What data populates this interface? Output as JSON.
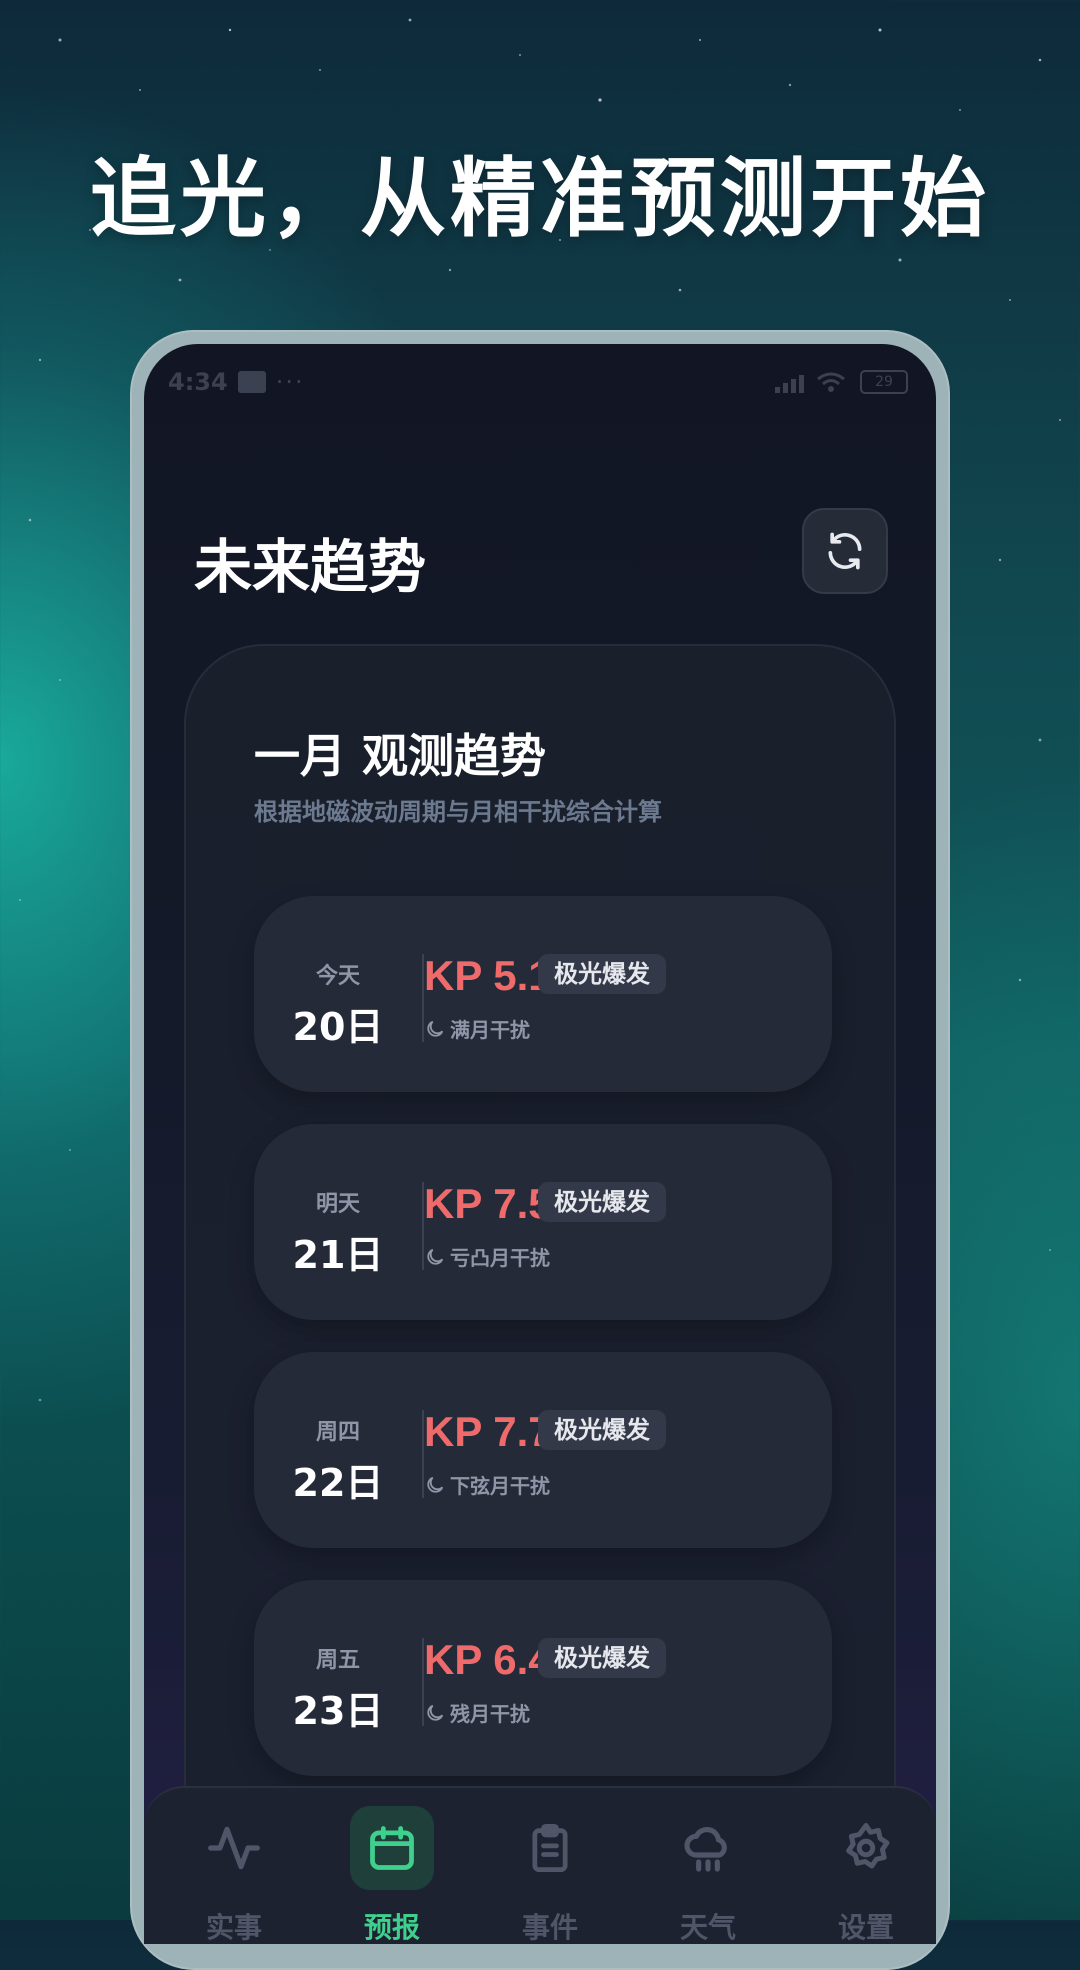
{
  "headline": "追光，从精准预测开始",
  "status_bar": {
    "time": "4:34",
    "dots": "···",
    "battery": "29"
  },
  "page": {
    "title": "未来趋势"
  },
  "trend_card": {
    "title": "一月 观测趋势",
    "subtitle": "根据地磁波动周期与月相干扰综合计算",
    "days": [
      {
        "weekday": "今天",
        "date": "20日",
        "kp": "KP 5.1",
        "badge": "极光爆发",
        "moon": "满月干扰"
      },
      {
        "weekday": "明天",
        "date": "21日",
        "kp": "KP 7.5",
        "badge": "极光爆发",
        "moon": "亏凸月干扰"
      },
      {
        "weekday": "周四",
        "date": "22日",
        "kp": "KP 7.7",
        "badge": "极光爆发",
        "moon": "下弦月干扰"
      },
      {
        "weekday": "周五",
        "date": "23日",
        "kp": "KP 6.4",
        "badge": "极光爆发",
        "moon": "残月干扰"
      }
    ]
  },
  "tabbar": {
    "items": [
      {
        "label": "实事",
        "icon": "pulse-icon",
        "active": false
      },
      {
        "label": "预报",
        "icon": "calendar-icon",
        "active": true
      },
      {
        "label": "事件",
        "icon": "clipboard-icon",
        "active": false
      },
      {
        "label": "天气",
        "icon": "cloud-rain-icon",
        "active": false
      },
      {
        "label": "设置",
        "icon": "gear-icon",
        "active": false
      }
    ]
  },
  "colors": {
    "kp_value": "#ef6b6b",
    "active_tab": "#3fd08e",
    "inactive_tab": "#4f5668"
  }
}
